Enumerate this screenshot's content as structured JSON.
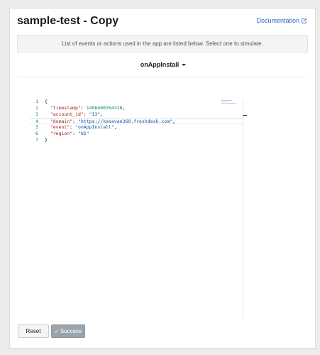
{
  "header": {
    "title": "sample-test - Copy",
    "doc_link": "Documentation"
  },
  "info": {
    "text": "List of events or actions used in the app are listed below. Select one to simulate."
  },
  "event_selector": {
    "selected": "onAppInstall"
  },
  "editor": {
    "line_numbers": [
      "1",
      "2",
      "3",
      "4",
      "5",
      "6",
      "7"
    ],
    "lines": [
      {
        "key": "",
        "value": "",
        "text": "{"
      },
      {
        "key": "\"timestamp\"",
        "value": "1496400354326",
        "text": ","
      },
      {
        "key": "\"account_id\"",
        "value": "\"13\"",
        "text": ","
      },
      {
        "key": "\"domain\"",
        "value": "\"https://kesavan360.freshdesk.com\"",
        "text": ","
      },
      {
        "key": "\"event\"",
        "value": "\"onAppInstall\"",
        "text": ","
      },
      {
        "key": "\"region\"",
        "value": "\"US\"",
        "text": ""
      },
      {
        "key": "",
        "value": "",
        "text": "}"
      }
    ]
  },
  "buttons": {
    "reset": "Reset",
    "success": "Success"
  },
  "icons": {
    "external": "external-link-icon",
    "check": "check-icon",
    "caret": "caret-down-icon"
  },
  "colors": {
    "link": "#2c6ab8",
    "key": "#a31515",
    "string": "#0451a5",
    "number": "#098658",
    "success_bg": "#9ba4ab"
  }
}
